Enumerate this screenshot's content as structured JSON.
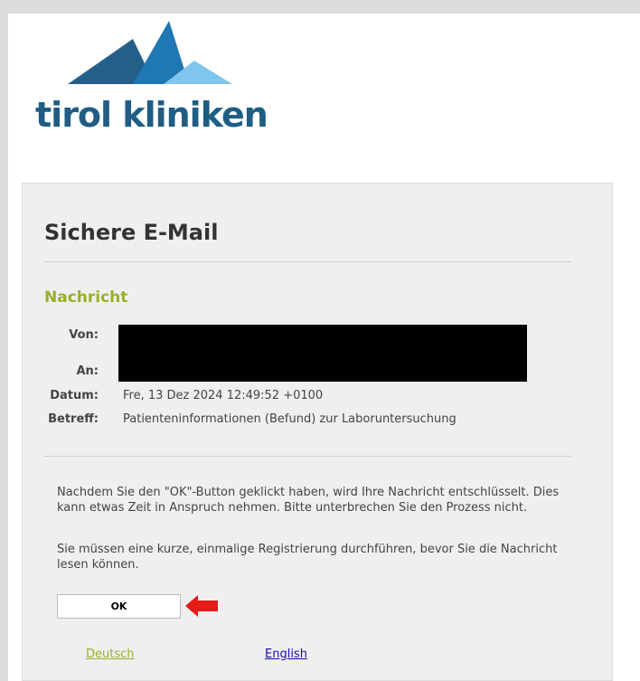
{
  "logo": {
    "text": "tirol kliniken"
  },
  "panel": {
    "title": "Sichere E-Mail",
    "section_title": "Nachricht",
    "fields": {
      "from_label": "Von:",
      "to_label": "An:",
      "date_label": "Datum:",
      "date_value": "Fre, 13 Dez 2024 12:49:52 +0100",
      "subject_label": "Betreff:",
      "subject_value": "Patienteninformationen (Befund) zur Laboruntersuchung"
    },
    "paragraph1": "Nachdem Sie den \"OK\"-Button geklickt haben, wird Ihre Nachricht entschlüsselt. Dies kann etwas Zeit in Anspruch nehmen. Bitte unterbrechen Sie den Prozess nicht.",
    "paragraph2": "Sie müssen eine kurze, einmalige Registrierung durchführen, bevor Sie die Nachricht lesen können.",
    "ok_label": "OK",
    "languages": {
      "german": "Deutsch",
      "english": "English"
    }
  },
  "colors": {
    "accent_green": "#9aaf26",
    "logo_blue": "#1f5d85",
    "arrow_red": "#e41b17"
  },
  "icons": {
    "arrow": "red-left-arrow-icon"
  }
}
